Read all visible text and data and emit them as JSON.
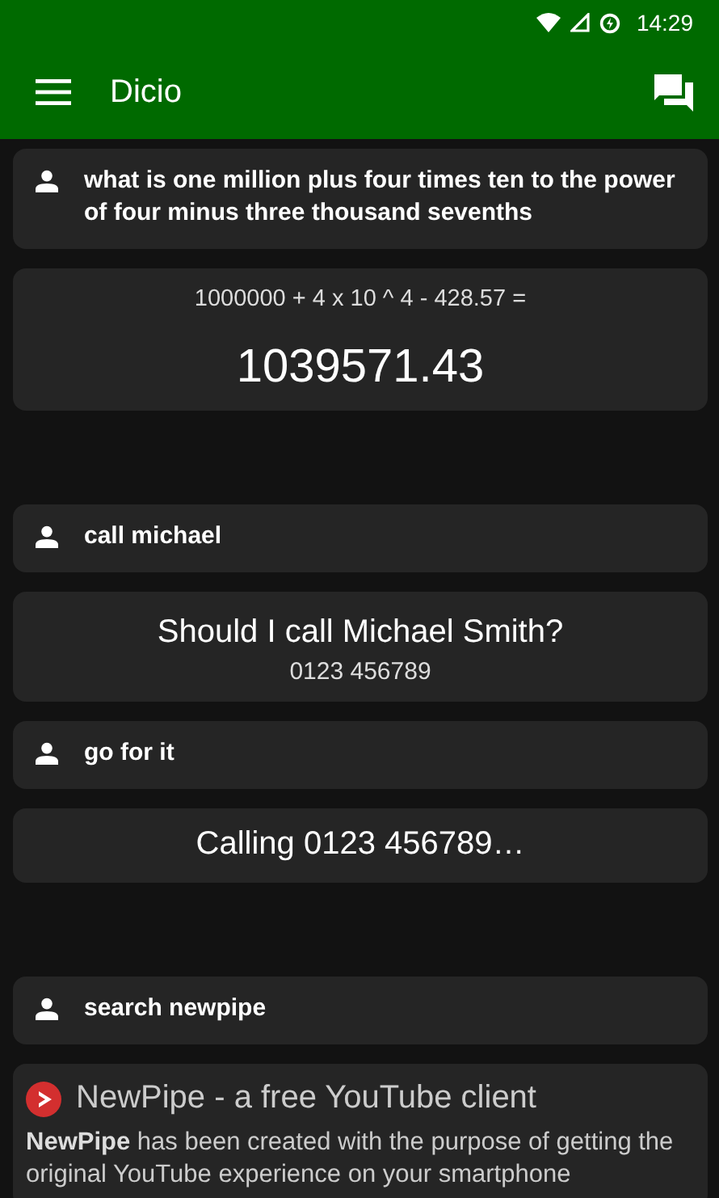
{
  "status_bar": {
    "time": "14:29"
  },
  "toolbar": {
    "title": "Dicio"
  },
  "conversations": [
    {
      "items": [
        {
          "kind": "user",
          "text": "what is one million plus four times ten to the power of four minus three thousand sevenths"
        },
        {
          "kind": "calculation",
          "expression": "1000000 + 4 x 10 ^ 4 - 428.57 =",
          "result": "1039571.43"
        }
      ]
    },
    {
      "items": [
        {
          "kind": "user",
          "text": "call michael"
        },
        {
          "kind": "call",
          "title": "Should I call Michael Smith?",
          "number": "0123 456789"
        },
        {
          "kind": "user",
          "text": "go for it"
        },
        {
          "kind": "message",
          "text": "Calling 0123 456789…"
        }
      ]
    },
    {
      "items": [
        {
          "kind": "user",
          "text": "search newpipe"
        },
        {
          "kind": "search",
          "title": "NewPipe - a free YouTube client",
          "description": "**NewPipe** has been created with the purpose of getting the original YouTube experience on your smartphone"
        }
      ]
    }
  ]
}
